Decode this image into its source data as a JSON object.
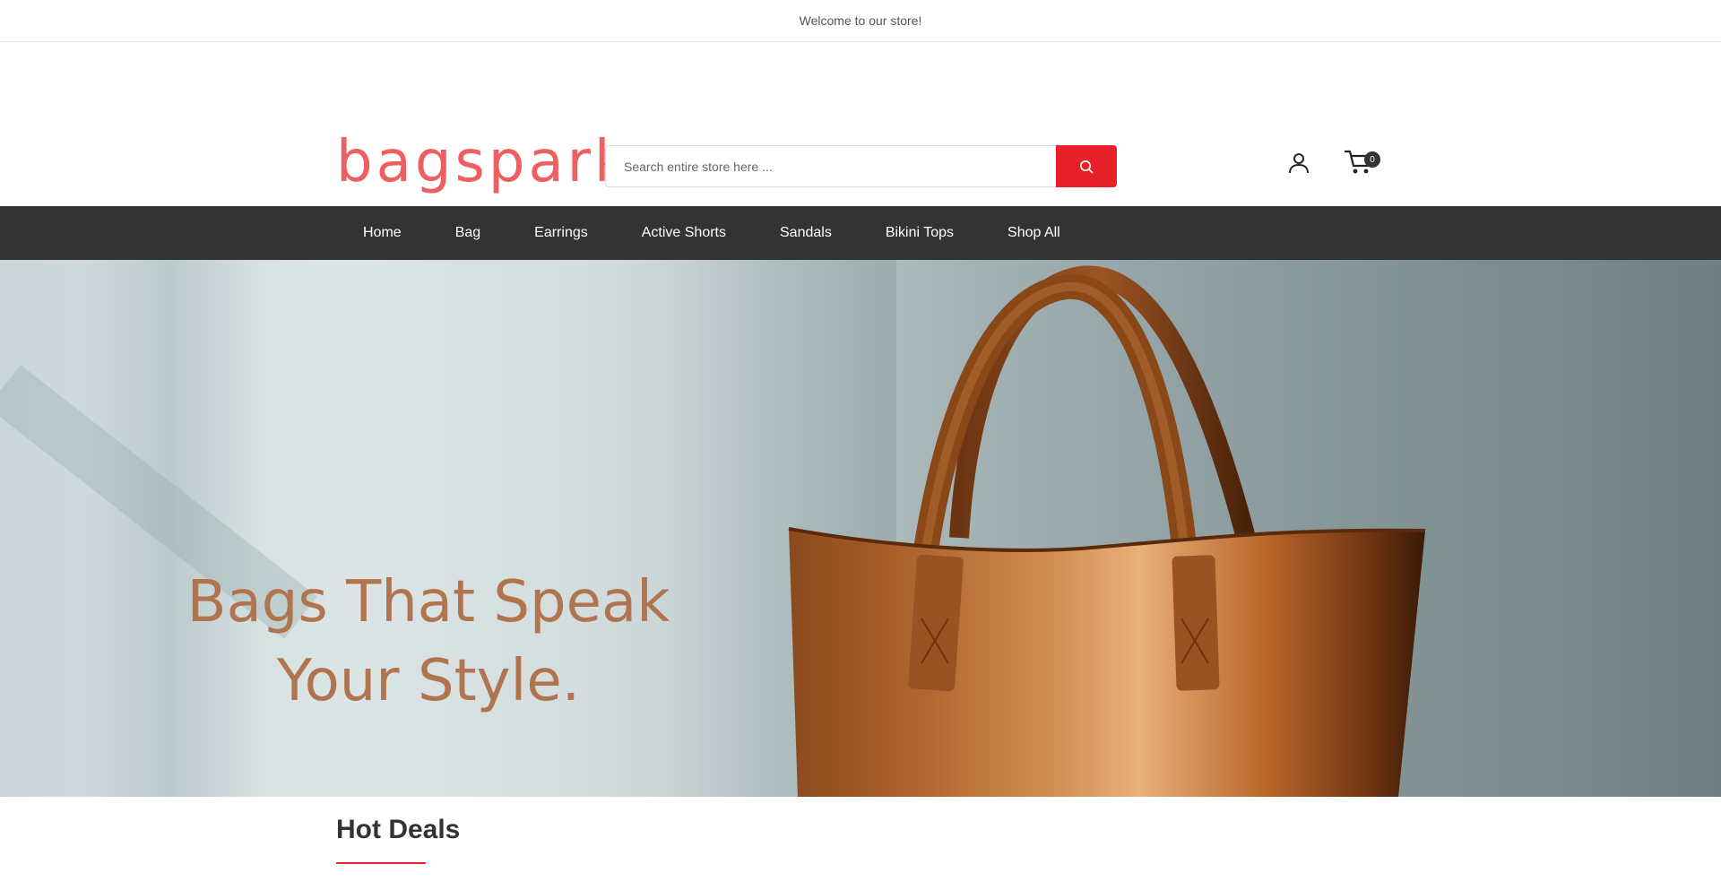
{
  "topbar": {
    "welcome_text": "Welcome to our store!"
  },
  "header": {
    "logo_text": "bagspark",
    "search": {
      "placeholder": "Search entire store here ...",
      "value": "",
      "button_icon": "search-icon"
    },
    "account_icon": "user-icon",
    "cart": {
      "icon": "cart-icon",
      "count": "0"
    }
  },
  "nav": {
    "items": [
      {
        "label": "Home"
      },
      {
        "label": "Bag"
      },
      {
        "label": "Earrings"
      },
      {
        "label": "Active Shorts"
      },
      {
        "label": "Sandals"
      },
      {
        "label": "Bikini Tops"
      },
      {
        "label": "Shop All"
      }
    ]
  },
  "hero": {
    "headline_line1": "Bags That Speak",
    "headline_line2": "Your Style."
  },
  "section": {
    "title": "Hot Deals"
  },
  "colors": {
    "accent": "#e8202a",
    "logo": "#ee5f61",
    "nav_bg": "#333333",
    "headline": "#b0744f"
  }
}
